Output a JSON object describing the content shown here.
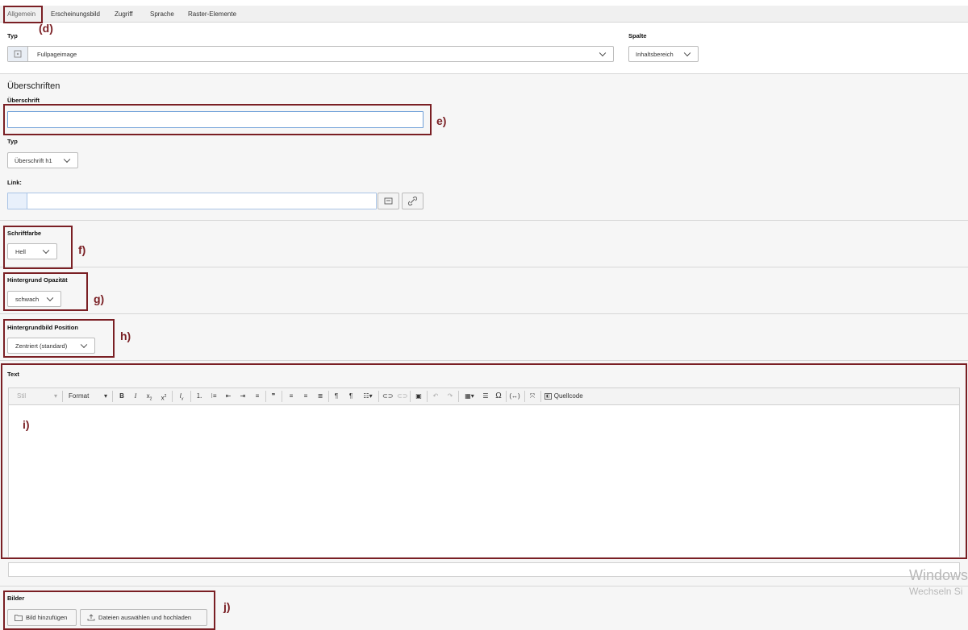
{
  "tabs": [
    "Allgemein",
    "Erscheinungsbild",
    "Zugriff",
    "Sprache",
    "Raster-Elemente"
  ],
  "type_section": {
    "typ_label": "Typ",
    "typ_value": "Fullpageimage",
    "spalte_label": "Spalte",
    "spalte_value": "Inhaltsbereich"
  },
  "headings_section": {
    "heading": "Überschriften",
    "ueberschrift_label": "Überschrift",
    "ueberschrift_value": "",
    "typ_label": "Typ",
    "typ_value": "Überschrift h1",
    "link_label": "Link:",
    "link_value": ""
  },
  "schriftfarbe": {
    "label": "Schriftfarbe",
    "value": "Hell"
  },
  "opazitaet": {
    "label": "Hintergrund Opazität",
    "value": "schwach"
  },
  "position": {
    "label": "Hintergrundbild Position",
    "value": "Zentriert (standard)"
  },
  "text_editor": {
    "label": "Text",
    "stil": "Stil",
    "format": "Format",
    "quellcode": "Quellcode"
  },
  "bilder": {
    "label": "Bilder",
    "add_button": "Bild hinzufügen",
    "upload_button": "Dateien auswählen und hochladen"
  },
  "annotations": {
    "d": "(d)",
    "e": "e)",
    "f": "f)",
    "g": "g)",
    "h": "h)",
    "i": "i)",
    "j": "j)"
  },
  "watermark": {
    "line1": "Windows",
    "line2": "Wechseln Si"
  },
  "colors": {
    "annotation": "#7a1f24",
    "input_border": "#6f9fd8"
  }
}
